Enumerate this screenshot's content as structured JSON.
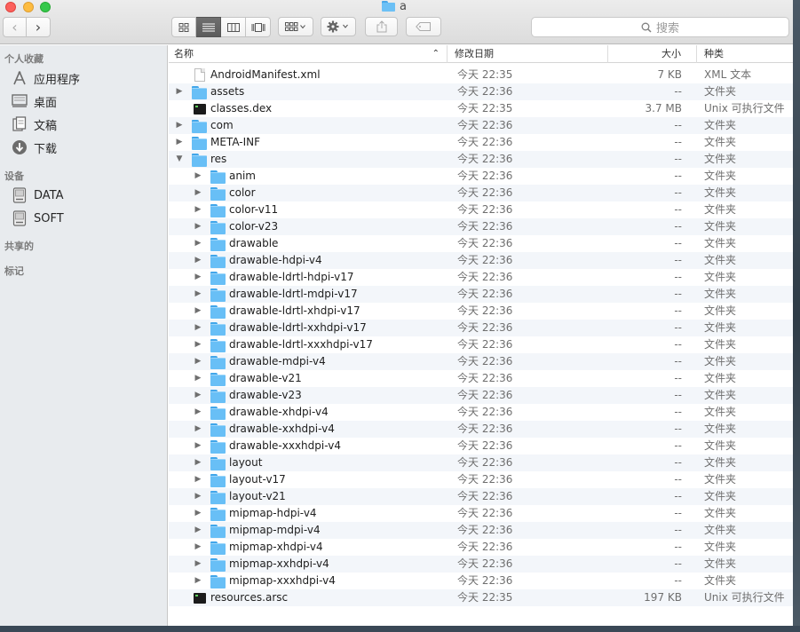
{
  "window": {
    "title": "a"
  },
  "toolbar": {
    "back_icon": "chevron-left-icon",
    "forward_icon": "chevron-right-icon",
    "views": [
      "icon-view",
      "list-view",
      "column-view",
      "coverflow-view"
    ],
    "active_view": "list-view",
    "arrange_icon": "arrange-grid-icon",
    "action_icon": "gear-icon",
    "share_icon": "share-icon",
    "tag_icon": "tag-icon",
    "search_placeholder": "搜索"
  },
  "sidebar": {
    "sections": [
      {
        "header": "个人收藏",
        "items": [
          {
            "label": "应用程序",
            "icon": "applications-icon"
          },
          {
            "label": "桌面",
            "icon": "desktop-icon"
          },
          {
            "label": "文稿",
            "icon": "documents-icon"
          },
          {
            "label": "下载",
            "icon": "downloads-icon"
          }
        ]
      },
      {
        "header": "设备",
        "items": [
          {
            "label": "DATA",
            "icon": "disk-icon"
          },
          {
            "label": "SOFT",
            "icon": "disk-icon"
          }
        ]
      },
      {
        "header": "共享的",
        "items": []
      },
      {
        "header": "标记",
        "items": []
      }
    ]
  },
  "columns": {
    "name": "名称",
    "date": "修改日期",
    "size": "大小",
    "kind": "种类"
  },
  "colors": {
    "folder": "#68bff6",
    "selection": "#5c5c5c",
    "sidebar_bg": "#e8ebee"
  },
  "rows": [
    {
      "name": "AndroidManifest.xml",
      "date": "今天 22:35",
      "size": "7 KB",
      "kind": "XML 文本",
      "level": 0,
      "type": "doc",
      "disclosure": ""
    },
    {
      "name": "assets",
      "date": "今天 22:36",
      "size": "--",
      "kind": "文件夹",
      "level": 0,
      "type": "folder",
      "disclosure": "▶"
    },
    {
      "name": "classes.dex",
      "date": "今天 22:35",
      "size": "3.7 MB",
      "kind": "Unix 可执行文件",
      "level": 0,
      "type": "exec",
      "disclosure": ""
    },
    {
      "name": "com",
      "date": "今天 22:36",
      "size": "--",
      "kind": "文件夹",
      "level": 0,
      "type": "folder",
      "disclosure": "▶"
    },
    {
      "name": "META-INF",
      "date": "今天 22:36",
      "size": "--",
      "kind": "文件夹",
      "level": 0,
      "type": "folder",
      "disclosure": "▶"
    },
    {
      "name": "res",
      "date": "今天 22:36",
      "size": "--",
      "kind": "文件夹",
      "level": 0,
      "type": "folder",
      "disclosure": "▼"
    },
    {
      "name": "anim",
      "date": "今天 22:36",
      "size": "--",
      "kind": "文件夹",
      "level": 1,
      "type": "folder",
      "disclosure": "▶"
    },
    {
      "name": "color",
      "date": "今天 22:36",
      "size": "--",
      "kind": "文件夹",
      "level": 1,
      "type": "folder",
      "disclosure": "▶"
    },
    {
      "name": "color-v11",
      "date": "今天 22:36",
      "size": "--",
      "kind": "文件夹",
      "level": 1,
      "type": "folder",
      "disclosure": "▶"
    },
    {
      "name": "color-v23",
      "date": "今天 22:36",
      "size": "--",
      "kind": "文件夹",
      "level": 1,
      "type": "folder",
      "disclosure": "▶"
    },
    {
      "name": "drawable",
      "date": "今天 22:36",
      "size": "--",
      "kind": "文件夹",
      "level": 1,
      "type": "folder",
      "disclosure": "▶"
    },
    {
      "name": "drawable-hdpi-v4",
      "date": "今天 22:36",
      "size": "--",
      "kind": "文件夹",
      "level": 1,
      "type": "folder",
      "disclosure": "▶"
    },
    {
      "name": "drawable-ldrtl-hdpi-v17",
      "date": "今天 22:36",
      "size": "--",
      "kind": "文件夹",
      "level": 1,
      "type": "folder",
      "disclosure": "▶"
    },
    {
      "name": "drawable-ldrtl-mdpi-v17",
      "date": "今天 22:36",
      "size": "--",
      "kind": "文件夹",
      "level": 1,
      "type": "folder",
      "disclosure": "▶"
    },
    {
      "name": "drawable-ldrtl-xhdpi-v17",
      "date": "今天 22:36",
      "size": "--",
      "kind": "文件夹",
      "level": 1,
      "type": "folder",
      "disclosure": "▶"
    },
    {
      "name": "drawable-ldrtl-xxhdpi-v17",
      "date": "今天 22:36",
      "size": "--",
      "kind": "文件夹",
      "level": 1,
      "type": "folder",
      "disclosure": "▶"
    },
    {
      "name": "drawable-ldrtl-xxxhdpi-v17",
      "date": "今天 22:36",
      "size": "--",
      "kind": "文件夹",
      "level": 1,
      "type": "folder",
      "disclosure": "▶"
    },
    {
      "name": "drawable-mdpi-v4",
      "date": "今天 22:36",
      "size": "--",
      "kind": "文件夹",
      "level": 1,
      "type": "folder",
      "disclosure": "▶"
    },
    {
      "name": "drawable-v21",
      "date": "今天 22:36",
      "size": "--",
      "kind": "文件夹",
      "level": 1,
      "type": "folder",
      "disclosure": "▶"
    },
    {
      "name": "drawable-v23",
      "date": "今天 22:36",
      "size": "--",
      "kind": "文件夹",
      "level": 1,
      "type": "folder",
      "disclosure": "▶"
    },
    {
      "name": "drawable-xhdpi-v4",
      "date": "今天 22:36",
      "size": "--",
      "kind": "文件夹",
      "level": 1,
      "type": "folder",
      "disclosure": "▶"
    },
    {
      "name": "drawable-xxhdpi-v4",
      "date": "今天 22:36",
      "size": "--",
      "kind": "文件夹",
      "level": 1,
      "type": "folder",
      "disclosure": "▶"
    },
    {
      "name": "drawable-xxxhdpi-v4",
      "date": "今天 22:36",
      "size": "--",
      "kind": "文件夹",
      "level": 1,
      "type": "folder",
      "disclosure": "▶"
    },
    {
      "name": "layout",
      "date": "今天 22:36",
      "size": "--",
      "kind": "文件夹",
      "level": 1,
      "type": "folder",
      "disclosure": "▶"
    },
    {
      "name": "layout-v17",
      "date": "今天 22:36",
      "size": "--",
      "kind": "文件夹",
      "level": 1,
      "type": "folder",
      "disclosure": "▶"
    },
    {
      "name": "layout-v21",
      "date": "今天 22:36",
      "size": "--",
      "kind": "文件夹",
      "level": 1,
      "type": "folder",
      "disclosure": "▶"
    },
    {
      "name": "mipmap-hdpi-v4",
      "date": "今天 22:36",
      "size": "--",
      "kind": "文件夹",
      "level": 1,
      "type": "folder",
      "disclosure": "▶"
    },
    {
      "name": "mipmap-mdpi-v4",
      "date": "今天 22:36",
      "size": "--",
      "kind": "文件夹",
      "level": 1,
      "type": "folder",
      "disclosure": "▶"
    },
    {
      "name": "mipmap-xhdpi-v4",
      "date": "今天 22:36",
      "size": "--",
      "kind": "文件夹",
      "level": 1,
      "type": "folder",
      "disclosure": "▶"
    },
    {
      "name": "mipmap-xxhdpi-v4",
      "date": "今天 22:36",
      "size": "--",
      "kind": "文件夹",
      "level": 1,
      "type": "folder",
      "disclosure": "▶"
    },
    {
      "name": "mipmap-xxxhdpi-v4",
      "date": "今天 22:36",
      "size": "--",
      "kind": "文件夹",
      "level": 1,
      "type": "folder",
      "disclosure": "▶"
    },
    {
      "name": "resources.arsc",
      "date": "今天 22:35",
      "size": "197 KB",
      "kind": "Unix 可执行文件",
      "level": 0,
      "type": "exec",
      "disclosure": ""
    }
  ]
}
